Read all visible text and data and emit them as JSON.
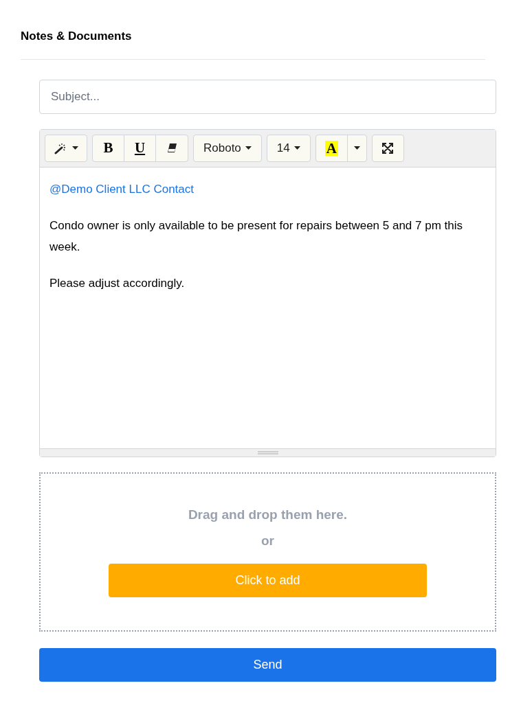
{
  "title": "Notes & Documents",
  "subject": {
    "placeholder": "Subject..."
  },
  "toolbar": {
    "bold": "B",
    "underline": "U",
    "font": "Roboto",
    "size": "14",
    "color_letter": "A"
  },
  "editor": {
    "mention": "@Demo Client LLC Contact",
    "paragraphs": [
      "Condo owner is only available to be present for repairs between 5 and 7 pm this week.",
      "Please adjust accordingly."
    ]
  },
  "dropzone": {
    "message": "Drag and drop them here.",
    "or": "or",
    "button": "Click to add"
  },
  "send": "Send"
}
